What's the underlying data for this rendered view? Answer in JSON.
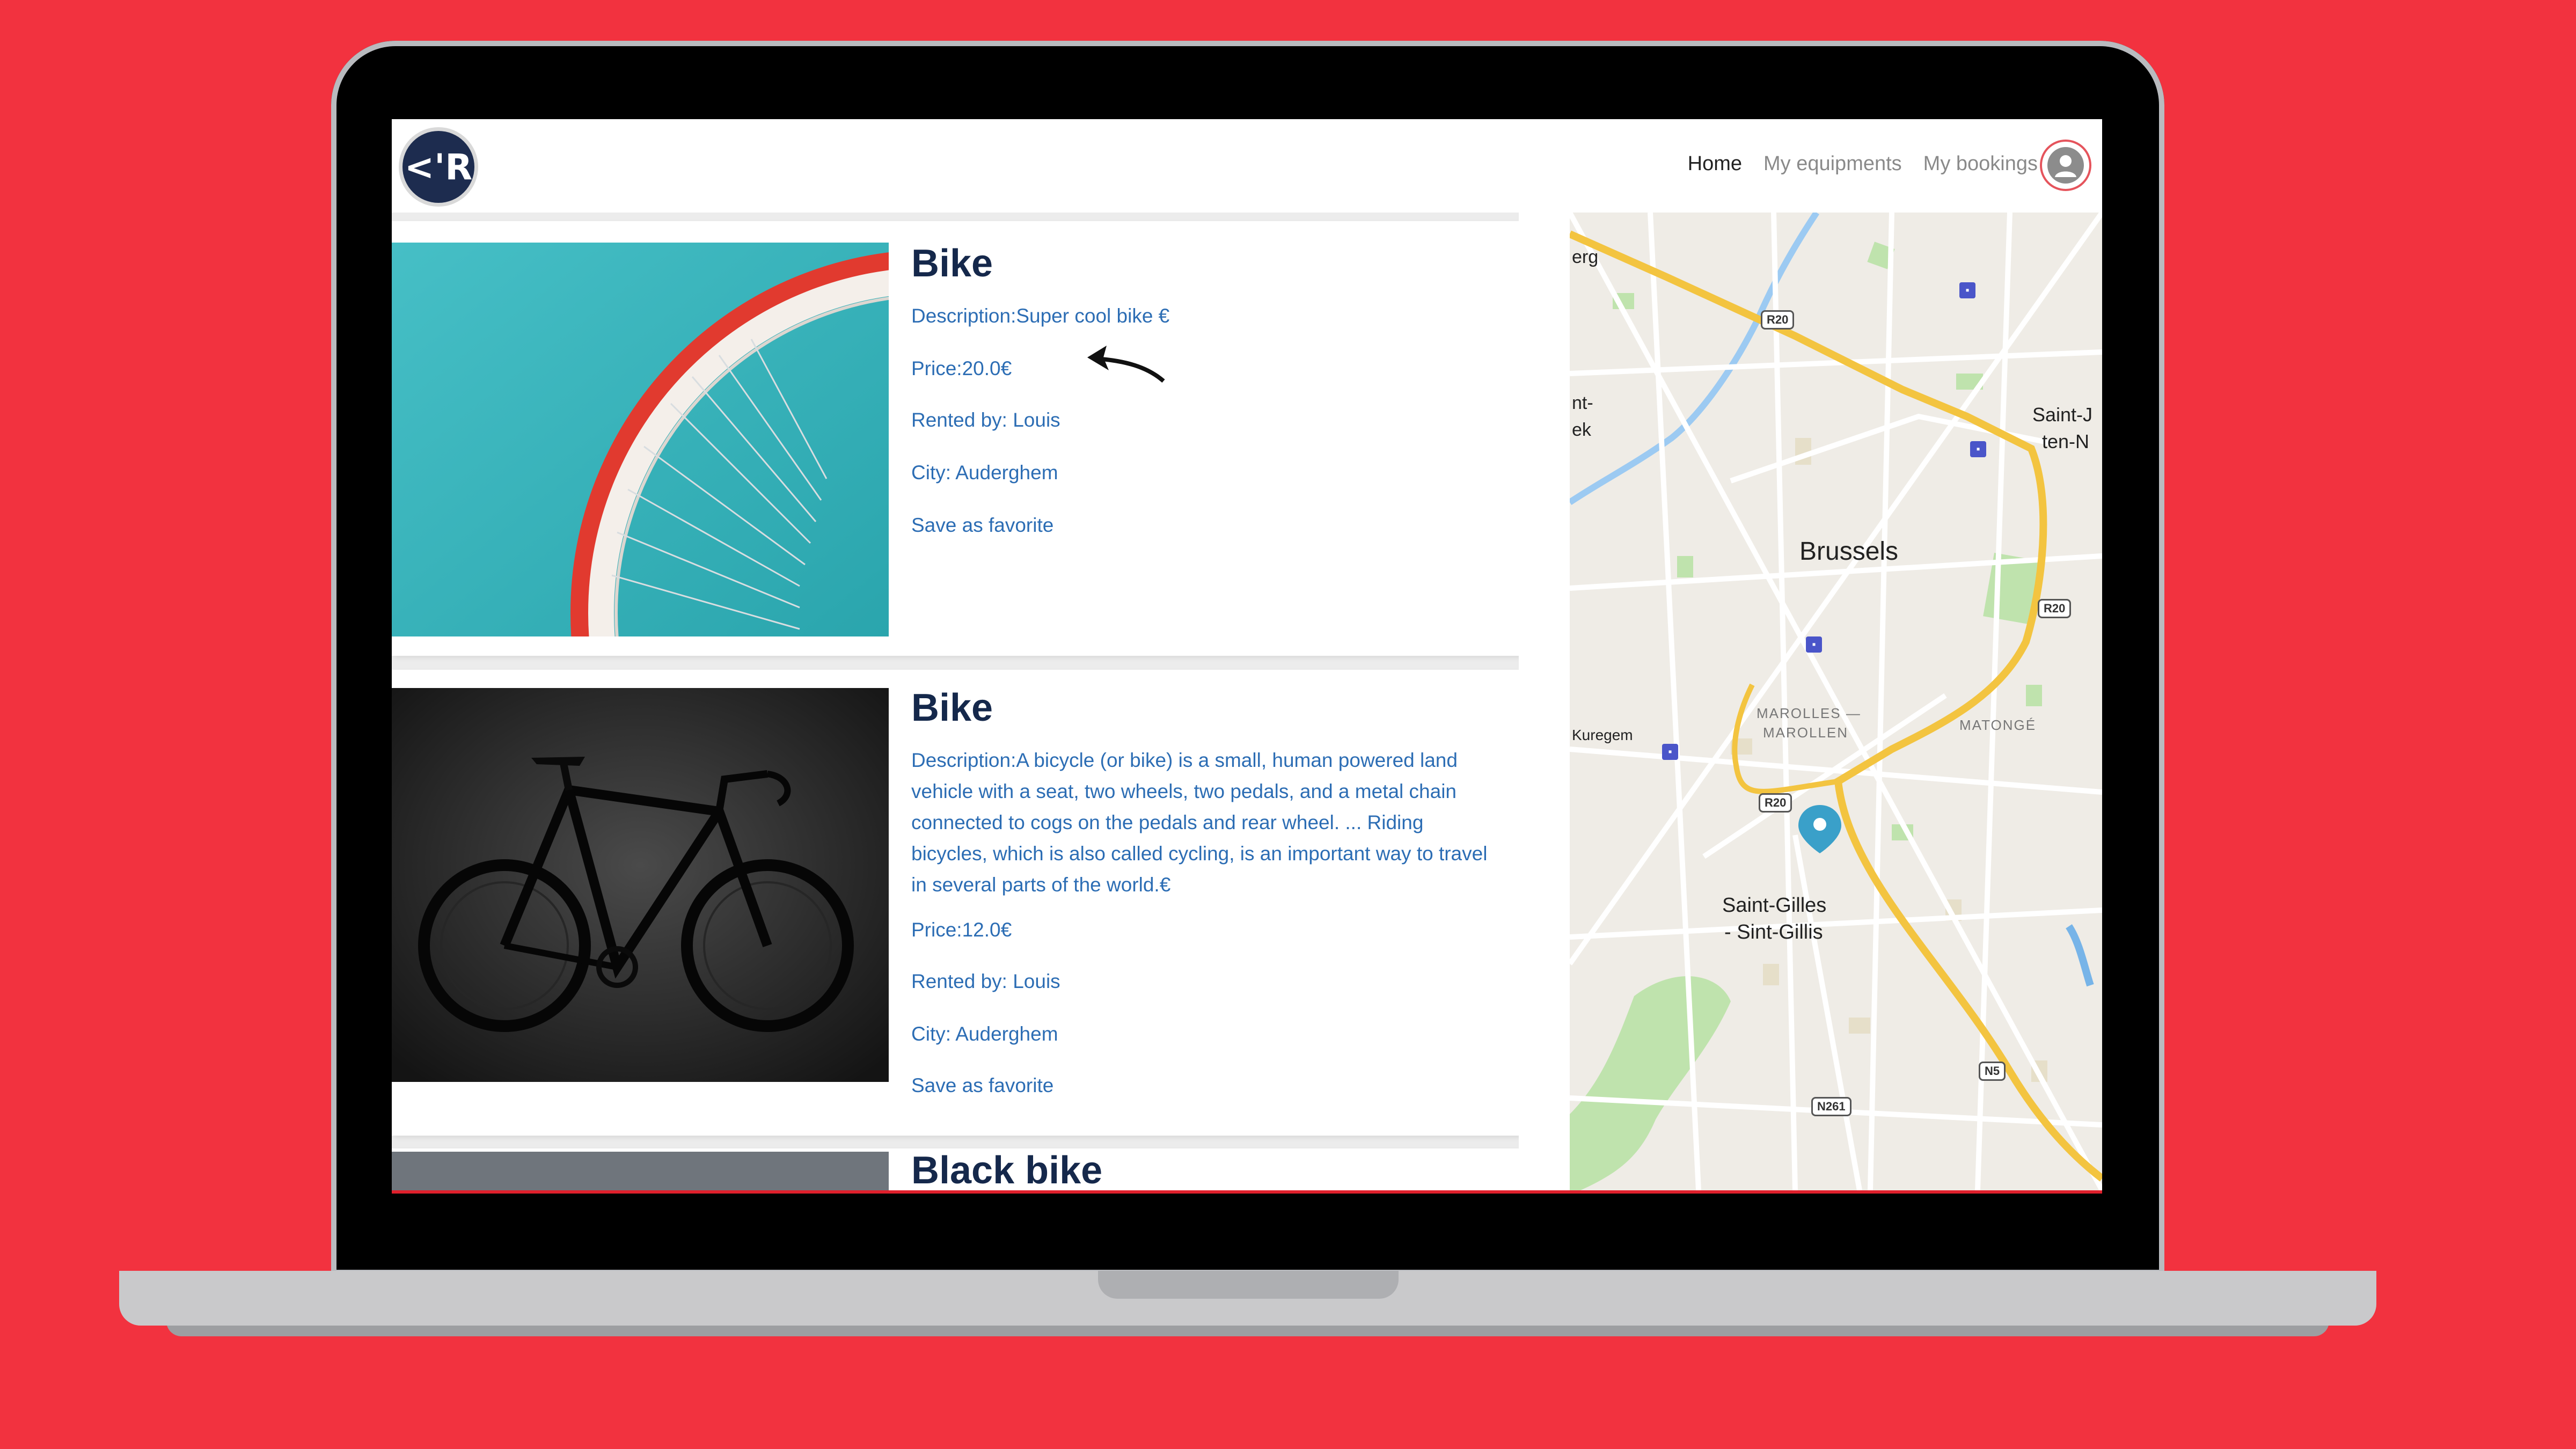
{
  "app": {
    "logo_text": "<'R"
  },
  "nav": {
    "home": "Home",
    "equipments": "My equipments",
    "bookings": "My bookings"
  },
  "listings": [
    {
      "title": "Bike",
      "description": "Description:Super cool bike €",
      "price": "Price:20.0€",
      "rented_by": "Rented by: Louis",
      "city": "City: Auderghem",
      "favorite": "Save as favorite"
    },
    {
      "title": "Bike",
      "description": "Description:A bicycle (or bike) is a small, human powered land vehicle with a seat, two wheels, two pedals, and a metal chain connected to cogs on the pedals and rear wheel. ... Riding bicycles, which is also called cycling, is an important way to travel in several parts of the world.€",
      "price": "Price:12.0€",
      "rented_by": "Rented by: Louis",
      "city": "City: Auderghem",
      "favorite": "Save as favorite"
    },
    {
      "title": "Black bike"
    }
  ],
  "map": {
    "city": "Brussels",
    "district_1": "Saint-Gilles",
    "district_1b": "- Sint-Gillis",
    "district_2a": "Saint-J",
    "district_2b": "ten-N",
    "marolles_a": "MAROLLES —",
    "marolles_b": "MAROLLEN",
    "matonge": "MATONGÉ",
    "kuregem": "Kuregem",
    "edge_1": "erg",
    "edge_2a": "nt-",
    "edge_2b": "ek",
    "r20": "R20",
    "n5": "N5",
    "n261": "N261"
  },
  "colors": {
    "background": "#f2323f",
    "title": "#15284b",
    "link": "#2c6db4",
    "logo": "#1d2c4f",
    "pin": "#3aa0c9",
    "ring_road": "#f3c440"
  }
}
